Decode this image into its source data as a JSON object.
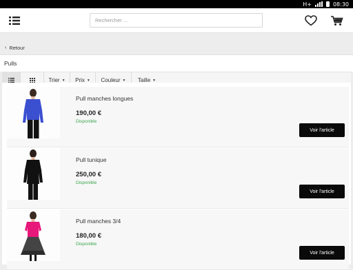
{
  "status": {
    "network": "H+",
    "time": "08:30"
  },
  "header": {
    "menu_icon": "list-menu-icon",
    "search_placeholder": "Rechercher ...",
    "wishlist_icon": "heart-icon",
    "cart_icon": "cart-icon"
  },
  "nav": {
    "back_label": "Retour"
  },
  "page": {
    "title": "Pulls"
  },
  "filters": {
    "view_list_icon": "list-view-icon",
    "view_grid_icon": "grid-view-icon",
    "items": [
      {
        "label": "Trier"
      },
      {
        "label": "Prix"
      },
      {
        "label": "Couleur"
      },
      {
        "label": "Taille"
      }
    ]
  },
  "colors": {
    "accent_button": "#0a0a0a",
    "available_text": "#3aa64c",
    "product_1_color": "#3b4fd1",
    "product_2_color": "#111111",
    "product_3_color": "#e8177a"
  },
  "products": [
    {
      "name": "Pull manches longues",
      "price": "190,00 €",
      "availability": "Disponible",
      "button": "Voir l'article"
    },
    {
      "name": "Pull tunique",
      "price": "250,00 €",
      "availability": "Disponible",
      "button": "Voir l'article"
    },
    {
      "name": "Pull manches 3/4",
      "price": "180,00 €",
      "availability": "Disponible",
      "button": "Voir l'article"
    }
  ]
}
